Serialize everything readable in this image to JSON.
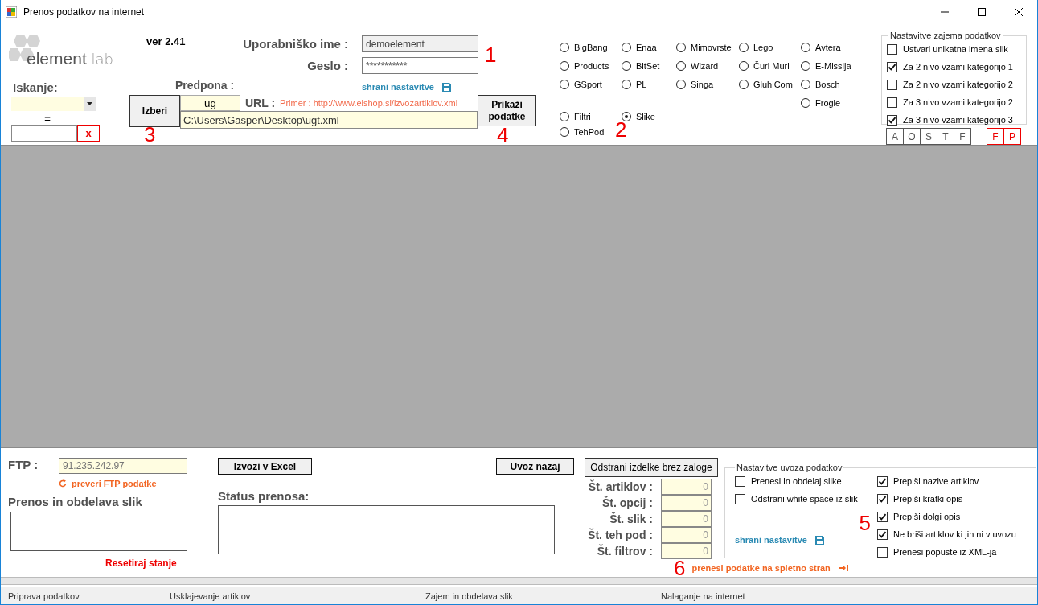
{
  "window": {
    "title": "Prenos podatkov na internet"
  },
  "logo": {
    "word": "element",
    "suffix": "lab"
  },
  "version": "ver 2.41",
  "search": {
    "label": "Iskanje:",
    "equals": "=",
    "clear_button": "x"
  },
  "login": {
    "username_label": "Uporabniško ime :",
    "username": "demoelement",
    "password_label": "Geslo :",
    "password": "***********",
    "save_link": "shrani nastavitve"
  },
  "source": {
    "prefix_label": "Predpona :",
    "prefix": "ug",
    "choose_button": "Izberi",
    "url_label": "URL :",
    "url_hint": "Primer : http://www.elshop.si/izvozartiklov.xml",
    "path": "C:\\Users\\Gasper\\Desktop\\ugt.xml",
    "show_button": "Prikaži podatke"
  },
  "annotation_numbers": {
    "login": "1",
    "choose": "3",
    "show": "4",
    "data_types": "2",
    "import": "5",
    "upload": "6"
  },
  "source_columns": [
    [
      {
        "label": "BigBang",
        "selected": false
      },
      {
        "label": "Products",
        "selected": false
      },
      {
        "label": "GSport",
        "selected": false
      }
    ],
    [
      {
        "label": "Enaa",
        "selected": false
      },
      {
        "label": "BitSet",
        "selected": false
      },
      {
        "label": "PL",
        "selected": false
      }
    ],
    [
      {
        "label": "Mimovrste",
        "selected": false
      },
      {
        "label": "Wizard",
        "selected": false
      },
      {
        "label": "Singa",
        "selected": false
      }
    ],
    [
      {
        "label": "Lego",
        "selected": false
      },
      {
        "label": "Čuri Muri",
        "selected": false
      },
      {
        "label": "GluhiCom",
        "selected": false
      }
    ],
    [
      {
        "label": "Avtera",
        "selected": false
      },
      {
        "label": "E-Missija",
        "selected": false
      },
      {
        "label": "Bosch",
        "selected": false
      },
      {
        "label": "Frogle",
        "selected": false
      }
    ]
  ],
  "data_types": [
    {
      "label": "Filtri",
      "selected": false
    },
    {
      "label": "Slike",
      "selected": true
    },
    {
      "label": "TehPod",
      "selected": false
    }
  ],
  "capture_settings": {
    "title": "Nastavitve zajema podatkov",
    "options": [
      {
        "label": "Ustvari unikatna imena slik",
        "checked": false
      },
      {
        "label": "Za 2 nivo vzami kategorijo 1",
        "checked": true
      },
      {
        "label": "Za 2 nivo vzami kategorijo 2",
        "checked": false
      },
      {
        "label": "Za 3 nivo vzami kategorijo 2",
        "checked": false
      },
      {
        "label": "Za 3 nivo vzami kategorijo 3",
        "checked": true
      }
    ]
  },
  "column_buttons": [
    "A",
    "O",
    "S",
    "T",
    "F"
  ],
  "red_buttons": [
    "F",
    "P"
  ],
  "ftp": {
    "label": "FTP :",
    "value": "91.235.242.97",
    "check_link": "preveri FTP podatke"
  },
  "images": {
    "title": "Prenos in obdelava slik",
    "reset_link": "Resetiraj stanje"
  },
  "export_button": "Izvozi v Excel",
  "import_back_button": "Uvoz nazaj",
  "status": {
    "title": "Status prenosa:"
  },
  "remove_button": "Odstrani izdelke brez zaloge",
  "counts": [
    {
      "label": "Št. artiklov :",
      "value": "0"
    },
    {
      "label": "Št. opcij :",
      "value": "0"
    },
    {
      "label": "Št. slik :",
      "value": "0"
    },
    {
      "label": "Št. teh pod :",
      "value": "0"
    },
    {
      "label": "Št. filtrov :",
      "value": "0"
    }
  ],
  "upload_link": "prenesi podatke na spletno stran",
  "import_settings": {
    "title": "Nastavitve uvoza podatkov",
    "save_link": "shrani nastavitve",
    "left": [
      {
        "label": "Prenesi in obdelaj slike",
        "checked": false
      },
      {
        "label": "Odstrani white space iz slik",
        "checked": false
      }
    ],
    "right": [
      {
        "label": "Prepiši nazive artiklov",
        "checked": true
      },
      {
        "label": "Prepiši kratki opis",
        "checked": true
      },
      {
        "label": "Prepiši dolgi opis",
        "checked": true
      },
      {
        "label": "Ne briši artiklov ki jih ni v uvozu",
        "checked": true
      },
      {
        "label": "Prenesi popuste iz XML-ja",
        "checked": false
      }
    ]
  },
  "status_bar": [
    "Priprava podatkov",
    "Usklajevanje artiklov",
    "Zajem in obdelava slik",
    "Nalaganje na internet"
  ]
}
